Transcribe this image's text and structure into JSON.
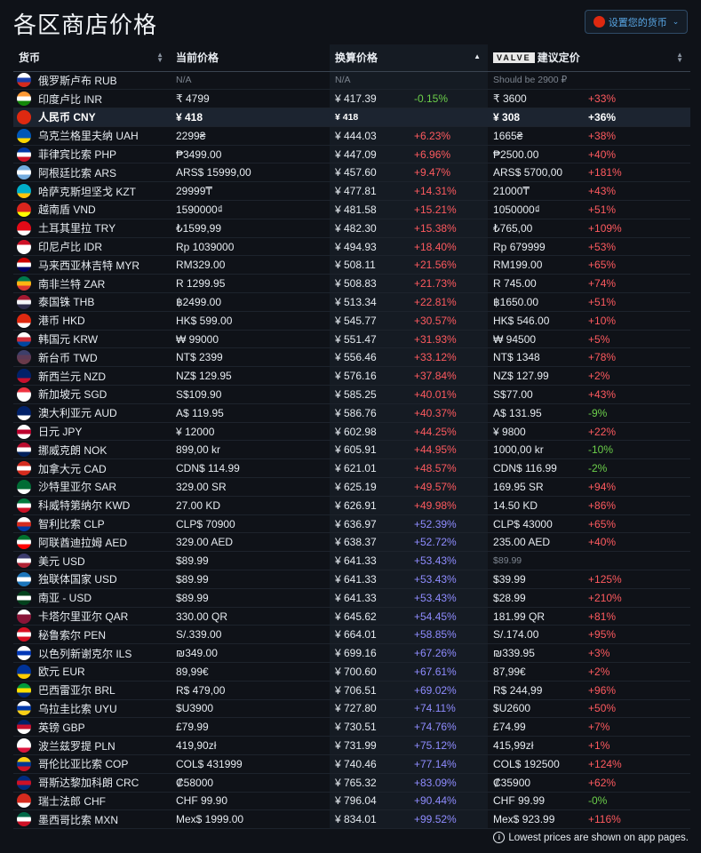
{
  "title": "各区商店价格",
  "currency_button": {
    "label": "设置您的货币",
    "flag": "#de2910"
  },
  "headers": {
    "currency": "货币",
    "current_price": "当前价格",
    "converted_price": "换算价格",
    "valve_logo": "VALVE",
    "msrp": "建议定价"
  },
  "rows": [
    {
      "flag": [
        "#ffffff",
        "#1c3fa8",
        "#d52b1e"
      ],
      "name": "俄罗斯卢布 RUB",
      "price": "N/A",
      "conv": "N/A",
      "conv_pct": "",
      "conv_cls": "",
      "msrp": "Should be 2900 ₽",
      "msrp_pct": "",
      "msrp_cls": "",
      "muted": true
    },
    {
      "flag": [
        "#ff9933",
        "#ffffff",
        "#138808"
      ],
      "name": "印度卢比 INR",
      "price": "₹ 4799",
      "conv": "¥ 417.39",
      "conv_pct": "-0.15%",
      "conv_cls": "neg",
      "msrp": "₹ 3600",
      "msrp_pct": "+33%",
      "msrp_cls": "pos"
    },
    {
      "flag": [
        "#de2910",
        "#de2910",
        "#de2910"
      ],
      "name": "人民币 CNY",
      "price": "¥ 418",
      "conv": "¥ 418",
      "conv_pct": "",
      "conv_cls": "",
      "msrp": "¥ 308",
      "msrp_pct": "+36%",
      "msrp_cls": "pos",
      "highlight": true
    },
    {
      "flag": [
        "#0057b7",
        "#0057b7",
        "#ffd700"
      ],
      "name": "乌克兰格里夫纳 UAH",
      "price": "2299₴",
      "conv": "¥ 444.03",
      "conv_pct": "+6.23%",
      "conv_cls": "pos",
      "msrp": "1665₴",
      "msrp_pct": "+38%",
      "msrp_cls": "pos"
    },
    {
      "flag": [
        "#0038a8",
        "#ffffff",
        "#ce1126"
      ],
      "name": "菲律宾比索 PHP",
      "price": "₱3499.00",
      "conv": "¥ 447.09",
      "conv_pct": "+6.96%",
      "conv_cls": "pos",
      "msrp": "₱2500.00",
      "msrp_pct": "+40%",
      "msrp_cls": "pos"
    },
    {
      "flag": [
        "#74acdf",
        "#ffffff",
        "#74acdf"
      ],
      "name": "阿根廷比索 ARS",
      "price": "ARS$ 15999,00",
      "conv": "¥ 457.60",
      "conv_pct": "+9.47%",
      "conv_cls": "pos",
      "msrp": "ARS$ 5700,00",
      "msrp_pct": "+181%",
      "msrp_cls": "pos"
    },
    {
      "flag": [
        "#00afca",
        "#00afca",
        "#fec50c"
      ],
      "name": "哈萨克斯坦坚戈 KZT",
      "price": "29999₸",
      "conv": "¥ 477.81",
      "conv_pct": "+14.31%",
      "conv_cls": "pos",
      "msrp": "21000₸",
      "msrp_pct": "+43%",
      "msrp_cls": "pos"
    },
    {
      "flag": [
        "#da251d",
        "#da251d",
        "#ffff00"
      ],
      "name": "越南盾 VND",
      "price": "1590000₫",
      "conv": "¥ 481.58",
      "conv_pct": "+15.21%",
      "conv_cls": "pos",
      "msrp": "1050000₫",
      "msrp_pct": "+51%",
      "msrp_cls": "pos"
    },
    {
      "flag": [
        "#e30a17",
        "#e30a17",
        "#ffffff"
      ],
      "name": "土耳其里拉 TRY",
      "price": "₺1599,99",
      "conv": "¥ 482.30",
      "conv_pct": "+15.38%",
      "conv_cls": "pos",
      "msrp": "₺765,00",
      "msrp_pct": "+109%",
      "msrp_cls": "pos"
    },
    {
      "flag": [
        "#ce1126",
        "#ffffff",
        "#ffffff"
      ],
      "name": "印尼卢比 IDR",
      "price": "Rp 1039000",
      "conv": "¥ 494.93",
      "conv_pct": "+18.40%",
      "conv_cls": "pos",
      "msrp": "Rp 679999",
      "msrp_pct": "+53%",
      "msrp_cls": "pos"
    },
    {
      "flag": [
        "#cc0001",
        "#ffffff",
        "#010066"
      ],
      "name": "马来西亚林吉特 MYR",
      "price": "RM329.00",
      "conv": "¥ 508.11",
      "conv_pct": "+21.56%",
      "conv_cls": "pos",
      "msrp": "RM199.00",
      "msrp_pct": "+65%",
      "msrp_cls": "pos"
    },
    {
      "flag": [
        "#007a4d",
        "#ffb612",
        "#de3831"
      ],
      "name": "南非兰特 ZAR",
      "price": "R 1299.95",
      "conv": "¥ 508.83",
      "conv_pct": "+21.73%",
      "conv_cls": "pos",
      "msrp": "R 745.00",
      "msrp_pct": "+74%",
      "msrp_cls": "pos"
    },
    {
      "flag": [
        "#a51931",
        "#f4f5f8",
        "#2d2a4a"
      ],
      "name": "泰国铢 THB",
      "price": "฿2499.00",
      "conv": "¥ 513.34",
      "conv_pct": "+22.81%",
      "conv_cls": "pos",
      "msrp": "฿1650.00",
      "msrp_pct": "+51%",
      "msrp_cls": "pos"
    },
    {
      "flag": [
        "#de2910",
        "#de2910",
        "#ffffff"
      ],
      "name": "港币 HKD",
      "price": "HK$ 599.00",
      "conv": "¥ 545.77",
      "conv_pct": "+30.57%",
      "conv_cls": "pos",
      "msrp": "HK$ 546.00",
      "msrp_pct": "+10%",
      "msrp_cls": "pos"
    },
    {
      "flag": [
        "#ffffff",
        "#cd2e3a",
        "#0047a0"
      ],
      "name": "韩国元 KRW",
      "price": "₩ 99000",
      "conv": "¥ 551.47",
      "conv_pct": "+31.93%",
      "conv_cls": "pos",
      "msrp": "₩ 94500",
      "msrp_pct": "+5%",
      "msrp_cls": "pos"
    },
    {
      "flag": [
        "#3d3f6a",
        "#5d3a55",
        "#6a3a4a"
      ],
      "name": "新台币 TWD",
      "price": "NT$ 2399",
      "conv": "¥ 556.46",
      "conv_pct": "+33.12%",
      "conv_cls": "pos",
      "msrp": "NT$ 1348",
      "msrp_pct": "+78%",
      "msrp_cls": "pos"
    },
    {
      "flag": [
        "#012169",
        "#012169",
        "#c8102e"
      ],
      "name": "新西兰元 NZD",
      "price": "NZ$ 129.95",
      "conv": "¥ 576.16",
      "conv_pct": "+37.84%",
      "conv_cls": "pos",
      "msrp": "NZ$ 127.99",
      "msrp_pct": "+2%",
      "msrp_cls": "pos"
    },
    {
      "flag": [
        "#ef3340",
        "#ffffff",
        "#ffffff"
      ],
      "name": "新加坡元 SGD",
      "price": "S$109.90",
      "conv": "¥ 585.25",
      "conv_pct": "+40.01%",
      "conv_cls": "pos",
      "msrp": "S$77.00",
      "msrp_pct": "+43%",
      "msrp_cls": "pos"
    },
    {
      "flag": [
        "#012169",
        "#012169",
        "#ffffff"
      ],
      "name": "澳大利亚元 AUD",
      "price": "A$ 119.95",
      "conv": "¥ 586.76",
      "conv_pct": "+40.37%",
      "conv_cls": "pos",
      "msrp": "A$ 131.95",
      "msrp_pct": "-9%",
      "msrp_cls": "neg"
    },
    {
      "flag": [
        "#ffffff",
        "#bc002d",
        "#ffffff"
      ],
      "name": "日元 JPY",
      "price": "¥ 12000",
      "conv": "¥ 602.98",
      "conv_pct": "+44.25%",
      "conv_cls": "pos",
      "msrp": "¥ 9800",
      "msrp_pct": "+22%",
      "msrp_cls": "pos"
    },
    {
      "flag": [
        "#ba0c2f",
        "#ffffff",
        "#00205b"
      ],
      "name": "挪威克朗 NOK",
      "price": "899,00 kr",
      "conv": "¥ 605.91",
      "conv_pct": "+44.95%",
      "conv_cls": "pos",
      "msrp": "1000,00 kr",
      "msrp_pct": "-10%",
      "msrp_cls": "neg"
    },
    {
      "flag": [
        "#d52b1e",
        "#ffffff",
        "#d52b1e"
      ],
      "name": "加拿大元 CAD",
      "price": "CDN$ 114.99",
      "conv": "¥ 621.01",
      "conv_pct": "+48.57%",
      "conv_cls": "pos",
      "msrp": "CDN$ 116.99",
      "msrp_pct": "-2%",
      "msrp_cls": "neg"
    },
    {
      "flag": [
        "#006c35",
        "#006c35",
        "#ffffff"
      ],
      "name": "沙特里亚尔 SAR",
      "price": "329.00 SR",
      "conv": "¥ 625.19",
      "conv_pct": "+49.57%",
      "conv_cls": "pos",
      "msrp": "169.95 SR",
      "msrp_pct": "+94%",
      "msrp_cls": "pos"
    },
    {
      "flag": [
        "#007a3d",
        "#ffffff",
        "#ce1126"
      ],
      "name": "科威特第纳尔 KWD",
      "price": "27.00 KD",
      "conv": "¥ 626.91",
      "conv_pct": "+49.98%",
      "conv_cls": "pos",
      "msrp": "14.50 KD",
      "msrp_pct": "+86%",
      "msrp_cls": "pos"
    },
    {
      "flag": [
        "#ffffff",
        "#d52b1e",
        "#0039a6"
      ],
      "name": "智利比索 CLP",
      "price": "CLP$ 70900",
      "conv": "¥ 636.97",
      "conv_pct": "+52.39%",
      "conv_cls": "purple",
      "msrp": "CLP$ 43000",
      "msrp_pct": "+65%",
      "msrp_cls": "pos"
    },
    {
      "flag": [
        "#00732f",
        "#ffffff",
        "#ff0000"
      ],
      "name": "阿联酋迪拉姆 AED",
      "price": "329.00 AED",
      "conv": "¥ 638.37",
      "conv_pct": "+52.72%",
      "conv_cls": "purple",
      "msrp": "235.00 AED",
      "msrp_pct": "+40%",
      "msrp_cls": "pos"
    },
    {
      "flag": [
        "#3c3b6e",
        "#ffffff",
        "#b22234"
      ],
      "name": "美元 USD",
      "price": "$89.99",
      "conv": "¥ 641.33",
      "conv_pct": "+53.43%",
      "conv_cls": "purple",
      "msrp": "$89.99",
      "msrp_pct": "",
      "msrp_cls": "",
      "msrp_muted": true
    },
    {
      "flag": [
        "#1b75bb",
        "#ffffff",
        "#1b75bb"
      ],
      "name": "独联体国家 USD",
      "price": "$89.99",
      "conv": "¥ 641.33",
      "conv_pct": "+53.43%",
      "conv_cls": "purple",
      "msrp": "$39.99",
      "msrp_pct": "+125%",
      "msrp_cls": "pos"
    },
    {
      "flag": [
        "#01411c",
        "#ffffff",
        "#01411c"
      ],
      "name": "南亚 - USD",
      "price": "$89.99",
      "conv": "¥ 641.33",
      "conv_pct": "+53.43%",
      "conv_cls": "purple",
      "msrp": "$28.99",
      "msrp_pct": "+210%",
      "msrp_cls": "pos"
    },
    {
      "flag": [
        "#ffffff",
        "#8a1538",
        "#8a1538"
      ],
      "name": "卡塔尔里亚尔 QAR",
      "price": "330.00 QR",
      "conv": "¥ 645.62",
      "conv_pct": "+54.45%",
      "conv_cls": "purple",
      "msrp": "181.99 QR",
      "msrp_pct": "+81%",
      "msrp_cls": "pos"
    },
    {
      "flag": [
        "#d91023",
        "#ffffff",
        "#d91023"
      ],
      "name": "秘鲁索尔 PEN",
      "price": "S/.339.00",
      "conv": "¥ 664.01",
      "conv_pct": "+58.85%",
      "conv_cls": "purple",
      "msrp": "S/.174.00",
      "msrp_pct": "+95%",
      "msrp_cls": "pos"
    },
    {
      "flag": [
        "#ffffff",
        "#0038b8",
        "#ffffff"
      ],
      "name": "以色列新谢克尔 ILS",
      "price": "₪349.00",
      "conv": "¥ 699.16",
      "conv_pct": "+67.26%",
      "conv_cls": "purple",
      "msrp": "₪339.95",
      "msrp_pct": "+3%",
      "msrp_cls": "pos"
    },
    {
      "flag": [
        "#003399",
        "#003399",
        "#ffcc00"
      ],
      "name": "欧元 EUR",
      "price": "89,99€",
      "conv": "¥ 700.60",
      "conv_pct": "+67.61%",
      "conv_cls": "purple",
      "msrp": "87,99€",
      "msrp_pct": "+2%",
      "msrp_cls": "pos"
    },
    {
      "flag": [
        "#009c3b",
        "#ffdf00",
        "#002776"
      ],
      "name": "巴西雷亚尔 BRL",
      "price": "R$ 479,00",
      "conv": "¥ 706.51",
      "conv_pct": "+69.02%",
      "conv_cls": "purple",
      "msrp": "R$ 244,99",
      "msrp_pct": "+96%",
      "msrp_cls": "pos"
    },
    {
      "flag": [
        "#ffffff",
        "#0038a8",
        "#fcd116"
      ],
      "name": "乌拉圭比索 UYU",
      "price": "$U3900",
      "conv": "¥ 727.80",
      "conv_pct": "+74.11%",
      "conv_cls": "purple",
      "msrp": "$U2600",
      "msrp_pct": "+50%",
      "msrp_cls": "pos"
    },
    {
      "flag": [
        "#012169",
        "#c8102e",
        "#ffffff"
      ],
      "name": "英镑 GBP",
      "price": "£79.99",
      "conv": "¥ 730.51",
      "conv_pct": "+74.76%",
      "conv_cls": "purple",
      "msrp": "£74.99",
      "msrp_pct": "+7%",
      "msrp_cls": "pos"
    },
    {
      "flag": [
        "#ffffff",
        "#ffffff",
        "#dc143c"
      ],
      "name": "波兰兹罗提 PLN",
      "price": "419,90zł",
      "conv": "¥ 731.99",
      "conv_pct": "+75.12%",
      "conv_cls": "purple",
      "msrp": "415,99zł",
      "msrp_pct": "+1%",
      "msrp_cls": "pos"
    },
    {
      "flag": [
        "#fcd116",
        "#003893",
        "#ce1126"
      ],
      "name": "哥伦比亚比索 COP",
      "price": "COL$ 431999",
      "conv": "¥ 740.46",
      "conv_pct": "+77.14%",
      "conv_cls": "purple",
      "msrp": "COL$ 192500",
      "msrp_pct": "+124%",
      "msrp_cls": "pos"
    },
    {
      "flag": [
        "#002b7f",
        "#ce1126",
        "#002b7f"
      ],
      "name": "哥斯达黎加科朗 CRC",
      "price": "₡58000",
      "conv": "¥ 765.32",
      "conv_pct": "+83.09%",
      "conv_cls": "purple",
      "msrp": "₡35900",
      "msrp_pct": "+62%",
      "msrp_cls": "pos"
    },
    {
      "flag": [
        "#d52b1e",
        "#d52b1e",
        "#ffffff"
      ],
      "name": "瑞士法郎 CHF",
      "price": "CHF 99.90",
      "conv": "¥ 796.04",
      "conv_pct": "+90.44%",
      "conv_cls": "purple",
      "msrp": "CHF 99.99",
      "msrp_pct": "-0%",
      "msrp_cls": "zero"
    },
    {
      "flag": [
        "#006847",
        "#ffffff",
        "#ce1126"
      ],
      "name": "墨西哥比索 MXN",
      "price": "Mex$ 1999.00",
      "conv": "¥ 834.01",
      "conv_pct": "+99.52%",
      "conv_cls": "purple",
      "msrp": "Mex$ 923.99",
      "msrp_pct": "+116%",
      "msrp_cls": "pos"
    }
  ],
  "footer": "Lowest prices are shown on app pages."
}
